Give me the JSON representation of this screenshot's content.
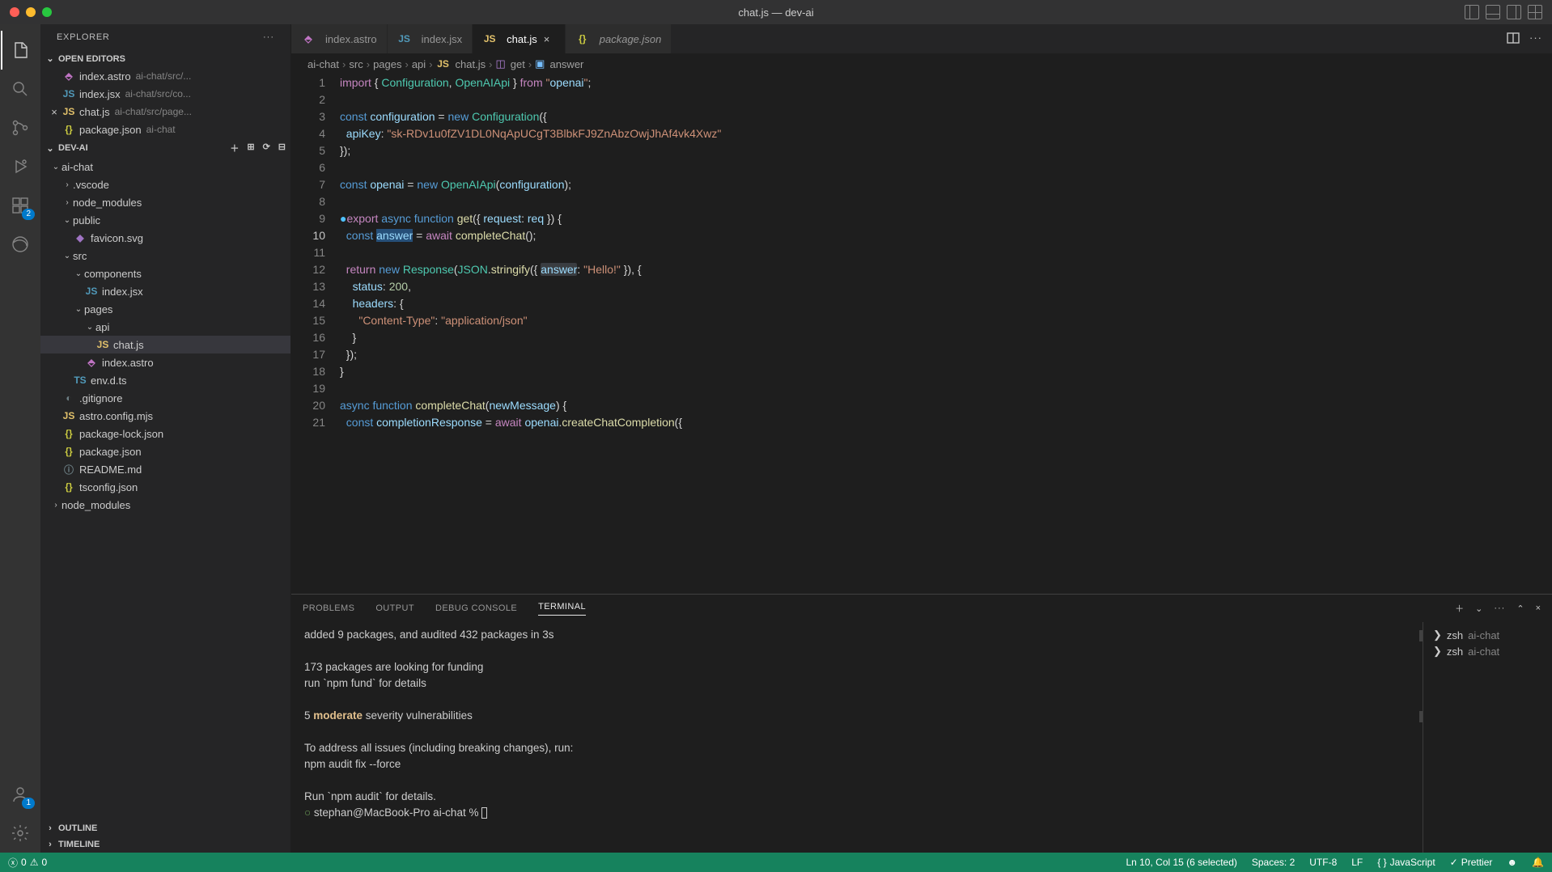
{
  "window": {
    "title": "chat.js — dev-ai"
  },
  "activity": {
    "extensions_badge": "2",
    "account_badge": "1"
  },
  "sidebar": {
    "title": "EXPLORER",
    "sections": {
      "open_editors": "OPEN EDITORS",
      "workspace": "DEV-AI",
      "outline": "OUTLINE",
      "timeline": "TIMELINE"
    },
    "open_editors": [
      {
        "name": "index.astro",
        "path": "ai-chat/src/..."
      },
      {
        "name": "index.jsx",
        "path": "ai-chat/src/co..."
      },
      {
        "name": "chat.js",
        "path": "ai-chat/src/page...",
        "current": true
      },
      {
        "name": "package.json",
        "path": "ai-chat"
      }
    ],
    "tree": {
      "ai_chat": "ai-chat",
      "vscode": ".vscode",
      "node_modules": "node_modules",
      "public": "public",
      "favicon": "favicon.svg",
      "src": "src",
      "components": "components",
      "index_jsx": "index.jsx",
      "pages": "pages",
      "api": "api",
      "chat_js": "chat.js",
      "index_astro": "index.astro",
      "env_d_ts": "env.d.ts",
      "gitignore": ".gitignore",
      "astro_config": "astro.config.mjs",
      "pkg_lock": "package-lock.json",
      "pkg_json": "package.json",
      "readme": "README.md",
      "tsconfig": "tsconfig.json",
      "node_modules2": "node_modules"
    }
  },
  "tabs": [
    {
      "label": "index.astro",
      "icon": "astro"
    },
    {
      "label": "index.jsx",
      "icon": "jsx"
    },
    {
      "label": "chat.js",
      "icon": "js",
      "active": true
    },
    {
      "label": "package.json",
      "icon": "json"
    }
  ],
  "breadcrumbs": [
    "ai-chat",
    "src",
    "pages",
    "api",
    "chat.js",
    "get",
    "answer"
  ],
  "editor": {
    "lines": [
      "import { Configuration, OpenAIApi } from \"openai\";",
      "",
      "const configuration = new Configuration({",
      "  apiKey: \"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\"",
      "});",
      "",
      "const openai = new OpenAIApi(configuration);",
      "",
      "export async function get({ request: req }) {",
      "  const answer = await completeChat();",
      "",
      "  return new Response(JSON.stringify({ answer: \"Hello!\" }), {",
      "    status: 200,",
      "    headers: {",
      "      \"Content-Type\": \"application/json\"",
      "    }",
      "  });",
      "}",
      "",
      "async function completeChat(newMessage) {",
      "  const completionResponse = await openai.createChatCompletion({"
    ],
    "current_line": 10
  },
  "panel": {
    "tabs": {
      "problems": "PROBLEMS",
      "output": "OUTPUT",
      "debug": "DEBUG CONSOLE",
      "terminal": "TERMINAL"
    },
    "terminal_lines": [
      "added 9 packages, and audited 432 packages in 3s",
      "",
      "173 packages are looking for funding",
      "  run `npm fund` for details",
      "",
      "5 moderate severity vulnerabilities",
      "",
      "To address all issues (including breaking changes), run:",
      "  npm audit fix --force",
      "",
      "Run `npm audit` for details.",
      "stephan@MacBook-Pro ai-chat % "
    ],
    "shells": [
      {
        "name": "zsh",
        "dir": "ai-chat"
      },
      {
        "name": "zsh",
        "dir": "ai-chat"
      }
    ]
  },
  "statusbar": {
    "errors": "0",
    "warnings": "0",
    "cursor": "Ln 10, Col 15 (6 selected)",
    "spaces": "Spaces: 2",
    "encoding": "UTF-8",
    "eol": "LF",
    "lang": "JavaScript",
    "prettier": "Prettier"
  },
  "colors": {
    "accent": "#007acc",
    "statusbar": "#16825d"
  }
}
